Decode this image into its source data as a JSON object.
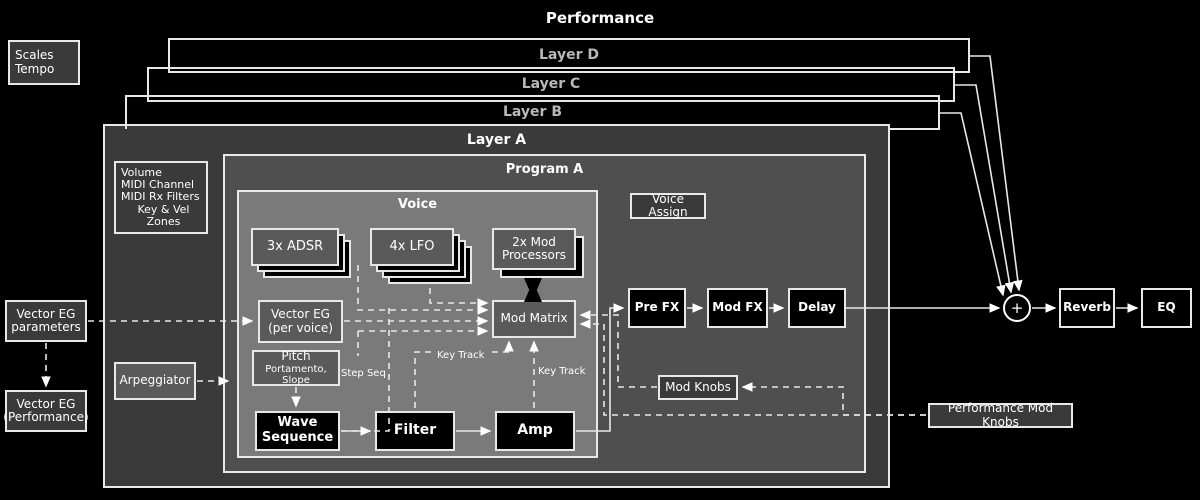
{
  "title": "Performance",
  "global_boxes": {
    "scales_tempo": {
      "line1": "Scales",
      "line2": "Tempo"
    },
    "vector_eg_parameters": {
      "line1": "Vector EG",
      "line2": "parameters"
    },
    "vector_eg_performance": {
      "line1": "Vector  EG",
      "line2": "(Performance)"
    },
    "performance_mod_knobs": "Performance Mod Knobs",
    "reverb": "Reverb",
    "eq": "EQ",
    "sum": "+"
  },
  "layers": [
    {
      "label": "Layer D"
    },
    {
      "label": "Layer C"
    },
    {
      "label": "Layer B"
    },
    {
      "label": "Layer A"
    }
  ],
  "layer_a": {
    "title": "Layer A",
    "settings": {
      "lines": [
        "Volume",
        "MIDI Channel",
        "MIDI Rx Filters",
        "Key & Vel Zones"
      ]
    },
    "arpeggiator": "Arpeggiator"
  },
  "program_a": {
    "title": "Program A",
    "voice": {
      "title": "Voice",
      "adsr": {
        "label": "3x ADSR",
        "count": 3
      },
      "lfo": {
        "label": "4x LFO",
        "count": 4
      },
      "mod_processors": {
        "line1": "2x Mod",
        "line2": "Processors",
        "count": 2
      },
      "vector_eg": {
        "line1": "Vector EG",
        "line2": "(per voice)"
      },
      "pitch": {
        "line1": "Pitch",
        "line2": "Portamento, Slope"
      },
      "mod_matrix": "Mod Matrix",
      "wave_sequence": {
        "line1": "Wave",
        "line2": "Sequence"
      },
      "filter": "Filter",
      "amp": "Amp",
      "edge_labels": {
        "step_seq": "Step Seq",
        "key_track_filter": "Key Track",
        "key_track_amp": "Key Track"
      }
    },
    "voice_assign": "Voice Assign",
    "fx_chain": [
      "Pre FX",
      "Mod FX",
      "Delay"
    ],
    "mod_knobs": "Mod Knobs"
  },
  "colors": {
    "background": "#000000",
    "stroke": "#e8e8e8",
    "layer_a_fill": "#3a3a3a",
    "program_fill": "#4f4f4f",
    "voice_fill": "#7a7a7a",
    "node_fill": "#5a5a5a",
    "black_node_fill": "#000000",
    "layer_text": "#b9b9b9"
  }
}
